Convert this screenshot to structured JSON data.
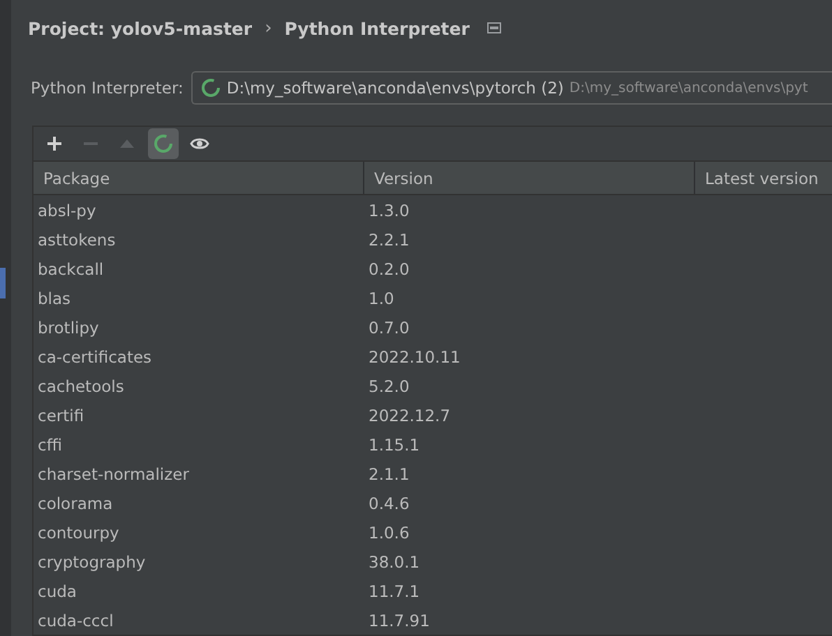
{
  "breadcrumb": {
    "project": "Project: yolov5-master",
    "separator": "›",
    "page": "Python Interpreter"
  },
  "interpreter": {
    "label": "Python Interpreter:",
    "value": "D:\\my_software\\anconda\\envs\\pytorch (2)",
    "path": "D:\\my_software\\anconda\\envs\\pyt"
  },
  "toolbar": [
    {
      "kind": "add",
      "disabled": false,
      "selected": false
    },
    {
      "kind": "remove",
      "disabled": true,
      "selected": false
    },
    {
      "kind": "upgrade",
      "disabled": true,
      "selected": false
    },
    {
      "kind": "loading",
      "disabled": false,
      "selected": true
    },
    {
      "kind": "show",
      "disabled": false,
      "selected": false
    }
  ],
  "table": {
    "columns": [
      "Package",
      "Version",
      "Latest version"
    ],
    "rows": [
      [
        "absl-py",
        "1.3.0"
      ],
      [
        "asttokens",
        "2.2.1"
      ],
      [
        "backcall",
        "0.2.0"
      ],
      [
        "blas",
        "1.0"
      ],
      [
        "brotlipy",
        "0.7.0"
      ],
      [
        "ca-certificates",
        "2022.10.11"
      ],
      [
        "cachetools",
        "5.2.0"
      ],
      [
        "certifi",
        "2022.12.7"
      ],
      [
        "cffi",
        "1.15.1"
      ],
      [
        "charset-normalizer",
        "2.1.1"
      ],
      [
        "colorama",
        "0.4.6"
      ],
      [
        "contourpy",
        "1.0.6"
      ],
      [
        "cryptography",
        "38.0.1"
      ],
      [
        "cuda",
        "11.7.1"
      ],
      [
        "cuda-cccl",
        "11.7.91"
      ]
    ]
  }
}
